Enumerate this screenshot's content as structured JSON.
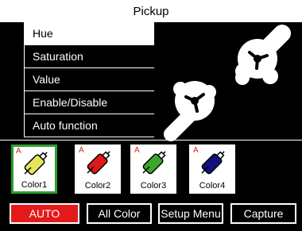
{
  "window": {
    "title": "Pickup"
  },
  "menu": {
    "items": [
      {
        "label": "Hue"
      },
      {
        "label": "Saturation"
      },
      {
        "label": "Value"
      },
      {
        "label": "Enable/Disable"
      },
      {
        "label": "Auto function"
      }
    ],
    "selected_index": 0
  },
  "swatches": [
    {
      "mark": "A",
      "label": "Color1",
      "color": "#e6e65a",
      "active": true
    },
    {
      "mark": "A",
      "label": "Color2",
      "color": "#e01818",
      "active": false
    },
    {
      "mark": "A",
      "label": "Color3",
      "color": "#3aa82a",
      "active": false
    },
    {
      "mark": "A",
      "label": "Color4",
      "color": "#101080",
      "active": false
    }
  ],
  "buttons": {
    "auto": "AUTO",
    "all_color": "All Color",
    "setup_menu": "Setup Menu",
    "capture": "Capture"
  },
  "colors": {
    "accent_red": "#e41a1a",
    "active_border": "#2e9e2e"
  }
}
